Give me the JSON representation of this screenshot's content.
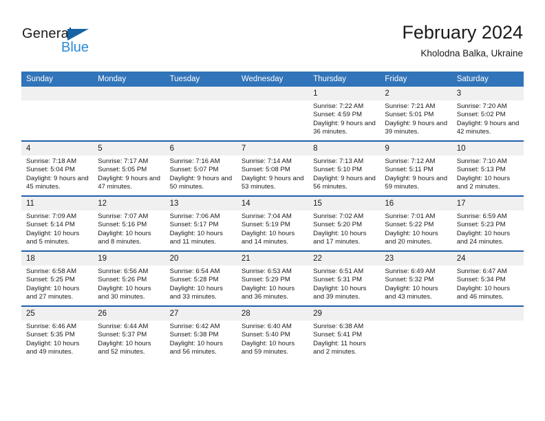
{
  "brand": {
    "name_part1": "General",
    "name_part2": "Blue",
    "accent_color": "#2b8ad6",
    "triangle_color": "#1464a5"
  },
  "header": {
    "title": "February 2024",
    "subtitle": "Kholodna Balka, Ukraine",
    "header_bg_color": "#3174b9",
    "row_divider_color": "#1f5fa9",
    "daynum_bg_color": "#f0f0f0"
  },
  "weekday_headers": [
    "Sunday",
    "Monday",
    "Tuesday",
    "Wednesday",
    "Thursday",
    "Friday",
    "Saturday"
  ],
  "weeks": [
    [
      {
        "day": "",
        "lines": []
      },
      {
        "day": "",
        "lines": []
      },
      {
        "day": "",
        "lines": []
      },
      {
        "day": "",
        "lines": []
      },
      {
        "day": "1",
        "lines": [
          "Sunrise: 7:22 AM",
          "Sunset: 4:59 PM",
          "Daylight: 9 hours and 36 minutes."
        ]
      },
      {
        "day": "2",
        "lines": [
          "Sunrise: 7:21 AM",
          "Sunset: 5:01 PM",
          "Daylight: 9 hours and 39 minutes."
        ]
      },
      {
        "day": "3",
        "lines": [
          "Sunrise: 7:20 AM",
          "Sunset: 5:02 PM",
          "Daylight: 9 hours and 42 minutes."
        ]
      }
    ],
    [
      {
        "day": "4",
        "lines": [
          "Sunrise: 7:18 AM",
          "Sunset: 5:04 PM",
          "Daylight: 9 hours and 45 minutes."
        ]
      },
      {
        "day": "5",
        "lines": [
          "Sunrise: 7:17 AM",
          "Sunset: 5:05 PM",
          "Daylight: 9 hours and 47 minutes."
        ]
      },
      {
        "day": "6",
        "lines": [
          "Sunrise: 7:16 AM",
          "Sunset: 5:07 PM",
          "Daylight: 9 hours and 50 minutes."
        ]
      },
      {
        "day": "7",
        "lines": [
          "Sunrise: 7:14 AM",
          "Sunset: 5:08 PM",
          "Daylight: 9 hours and 53 minutes."
        ]
      },
      {
        "day": "8",
        "lines": [
          "Sunrise: 7:13 AM",
          "Sunset: 5:10 PM",
          "Daylight: 9 hours and 56 minutes."
        ]
      },
      {
        "day": "9",
        "lines": [
          "Sunrise: 7:12 AM",
          "Sunset: 5:11 PM",
          "Daylight: 9 hours and 59 minutes."
        ]
      },
      {
        "day": "10",
        "lines": [
          "Sunrise: 7:10 AM",
          "Sunset: 5:13 PM",
          "Daylight: 10 hours and 2 minutes."
        ]
      }
    ],
    [
      {
        "day": "11",
        "lines": [
          "Sunrise: 7:09 AM",
          "Sunset: 5:14 PM",
          "Daylight: 10 hours and 5 minutes."
        ]
      },
      {
        "day": "12",
        "lines": [
          "Sunrise: 7:07 AM",
          "Sunset: 5:16 PM",
          "Daylight: 10 hours and 8 minutes."
        ]
      },
      {
        "day": "13",
        "lines": [
          "Sunrise: 7:06 AM",
          "Sunset: 5:17 PM",
          "Daylight: 10 hours and 11 minutes."
        ]
      },
      {
        "day": "14",
        "lines": [
          "Sunrise: 7:04 AM",
          "Sunset: 5:19 PM",
          "Daylight: 10 hours and 14 minutes."
        ]
      },
      {
        "day": "15",
        "lines": [
          "Sunrise: 7:02 AM",
          "Sunset: 5:20 PM",
          "Daylight: 10 hours and 17 minutes."
        ]
      },
      {
        "day": "16",
        "lines": [
          "Sunrise: 7:01 AM",
          "Sunset: 5:22 PM",
          "Daylight: 10 hours and 20 minutes."
        ]
      },
      {
        "day": "17",
        "lines": [
          "Sunrise: 6:59 AM",
          "Sunset: 5:23 PM",
          "Daylight: 10 hours and 24 minutes."
        ]
      }
    ],
    [
      {
        "day": "18",
        "lines": [
          "Sunrise: 6:58 AM",
          "Sunset: 5:25 PM",
          "Daylight: 10 hours and 27 minutes."
        ]
      },
      {
        "day": "19",
        "lines": [
          "Sunrise: 6:56 AM",
          "Sunset: 5:26 PM",
          "Daylight: 10 hours and 30 minutes."
        ]
      },
      {
        "day": "20",
        "lines": [
          "Sunrise: 6:54 AM",
          "Sunset: 5:28 PM",
          "Daylight: 10 hours and 33 minutes."
        ]
      },
      {
        "day": "21",
        "lines": [
          "Sunrise: 6:53 AM",
          "Sunset: 5:29 PM",
          "Daylight: 10 hours and 36 minutes."
        ]
      },
      {
        "day": "22",
        "lines": [
          "Sunrise: 6:51 AM",
          "Sunset: 5:31 PM",
          "Daylight: 10 hours and 39 minutes."
        ]
      },
      {
        "day": "23",
        "lines": [
          "Sunrise: 6:49 AM",
          "Sunset: 5:32 PM",
          "Daylight: 10 hours and 43 minutes."
        ]
      },
      {
        "day": "24",
        "lines": [
          "Sunrise: 6:47 AM",
          "Sunset: 5:34 PM",
          "Daylight: 10 hours and 46 minutes."
        ]
      }
    ],
    [
      {
        "day": "25",
        "lines": [
          "Sunrise: 6:46 AM",
          "Sunset: 5:35 PM",
          "Daylight: 10 hours and 49 minutes."
        ]
      },
      {
        "day": "26",
        "lines": [
          "Sunrise: 6:44 AM",
          "Sunset: 5:37 PM",
          "Daylight: 10 hours and 52 minutes."
        ]
      },
      {
        "day": "27",
        "lines": [
          "Sunrise: 6:42 AM",
          "Sunset: 5:38 PM",
          "Daylight: 10 hours and 56 minutes."
        ]
      },
      {
        "day": "28",
        "lines": [
          "Sunrise: 6:40 AM",
          "Sunset: 5:40 PM",
          "Daylight: 10 hours and 59 minutes."
        ]
      },
      {
        "day": "29",
        "lines": [
          "Sunrise: 6:38 AM",
          "Sunset: 5:41 PM",
          "Daylight: 11 hours and 2 minutes."
        ]
      },
      {
        "day": "",
        "lines": []
      },
      {
        "day": "",
        "lines": []
      }
    ]
  ]
}
